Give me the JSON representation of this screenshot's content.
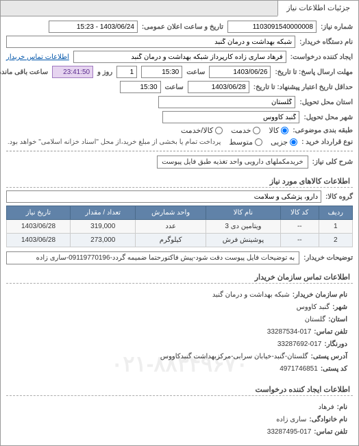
{
  "tabs": {
    "info": "جزئیات اطلاعات نیاز"
  },
  "header": {
    "need_no_label": "شماره نیاز:",
    "need_no": "1103091540000008",
    "announce_label": "تاریخ و ساعت اعلان عمومی:",
    "announce": "1403/06/24 - 15:23",
    "buyer_org_label": "نام دستگاه خریدار:",
    "buyer_org": "شبکه بهداشت و درمان گنبد",
    "requester_label": "ایجاد کننده درخواست:",
    "requester": "فرهاد ساری زاده کارپرداز شبکه بهداشت و درمان گنبد",
    "buyer_contact_link": "اطلاعات تماس خریدار"
  },
  "dates": {
    "reply_until_label": "مهلت ارسال پاسخ: تا تاریخ:",
    "reply_date": "1403/06/26",
    "time_label": "ساعت",
    "reply_time": "15:30",
    "days_label": "روز و",
    "days_left": "1",
    "time_left": "23:41:50",
    "remaining_label": "ساعت باقی مانده",
    "valid_until_label": "حداقل تاریخ اعتبار پیشنهاد: تا تاریخ:",
    "valid_date": "1403/06/28",
    "valid_time": "15:30",
    "province_label": "استان محل تحویل:",
    "province": "گلستان",
    "city_label": "شهر محل تحویل:",
    "city": "گنبد کاووس"
  },
  "classification": {
    "type_label": "طبقه بندی موضوعی:",
    "goods": "کالا",
    "service": "خدمت",
    "mixed": "کالا/خدمت",
    "part_label": "نوع قرارداد خرید :",
    "minor": "جزیی",
    "medium": "متوسط",
    "major_note": "پرداخت تمام یا بخشی از مبلغ خرید،از محل \"اسناد خزانه اسلامی\" خواهد بود."
  },
  "need": {
    "desc_label": "شرح کلی نیاز:",
    "desc": "خریدمکملهای دارویی واحد تغذیه طبق فایل پیوست"
  },
  "items_header": "اطلاعات کالاهای مورد نیاز",
  "group": {
    "label": "گروه کالا:",
    "value": "دارو، پزشکی و سلامت"
  },
  "table": {
    "cols": [
      "ردیف",
      "کد کالا",
      "نام کالا",
      "واحد شمارش",
      "تعداد / مقدار",
      "تاریخ نیاز"
    ],
    "rows": [
      {
        "idx": "1",
        "code": "--",
        "name": "ویتامین دی 3",
        "unit": "عدد",
        "qty": "319,000",
        "date": "1403/06/28"
      },
      {
        "idx": "2",
        "code": "--",
        "name": "پوشینش فرش",
        "unit": "کیلوگرم",
        "qty": "273,000",
        "date": "1403/06/28"
      }
    ]
  },
  "buyer_note": {
    "label": "توضیحات خریدار:",
    "text": "به توضیحات فایل پیوست دقت شود-پیش فاکتورحتما ضمیمه گردد-09119770196-ساری زاده"
  },
  "contacts_header": "اطلاعات تماس سازمان خریدار",
  "org": {
    "name_label": "نام سازمان خریدار:",
    "name": "شبکه بهداشت و درمان گنبد",
    "city_label": "شهر:",
    "city": "گنبد کاووس",
    "province_label": "استان:",
    "province": "گلستان",
    "phone_label": "تلفن تماس:",
    "phone": "33287534-017",
    "fax_label": "دورنگار:",
    "fax": "33287692-017",
    "address_label": "آدرس پستی:",
    "address": "گلستان-گنبد-خیابان سرابی-مرکزبهداشت گنبدکاووس",
    "postal_label": "کد پستی:",
    "postal": "4971746851"
  },
  "requester_header": "اطلاعات ایجاد کننده درخواست",
  "req_person": {
    "fname_label": "نام:",
    "fname": "فرهاد",
    "lname_label": "نام خانوادگی:",
    "lname": "ساری زاده",
    "phone_label": "تلفن تماس:",
    "phone": "33287495-017"
  },
  "watermark": "۰۲۱-۸۸۳۴۹۶۷۰"
}
